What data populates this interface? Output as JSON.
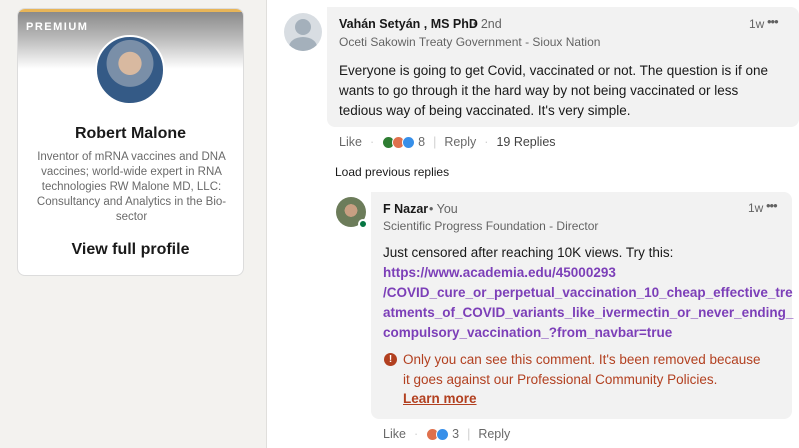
{
  "profile": {
    "badge": "PREMIUM",
    "name": "Robert Malone",
    "headline": "Inventor of mRNA vaccines and DNA vaccines; world-wide expert in RNA technologies RW Malone MD, LLC: Consultancy and Analytics in the Bio-sector",
    "view_profile": "View full profile"
  },
  "comment": {
    "author": "Vahán Setyán , MS PhD",
    "degree": "• 2nd",
    "subtitle": "Oceti Sakowin Treaty Government - Sioux Nation",
    "time": "1w",
    "more": "•••",
    "text": "Everyone is going to get Covid, vaccinated or not. The question is if one wants to go through it the hard way by not being vaccinated or less tedious way of being vaccinated. It's very simple.",
    "like": "Like",
    "reaction_count": "8",
    "reply": "Reply",
    "replies": "19 Replies"
  },
  "load_previous": "Load previous replies",
  "reply": {
    "author": "F Nazar",
    "you": "• You",
    "subtitle": "Scientific Progress Foundation - Director",
    "time": "1w",
    "more": "•••",
    "text_intro": "Just censored after reaching 10K views. Try this:",
    "link_line1": "https://www.academia.edu/45000293",
    "link_line2": "/COVID_cure_or_perpetual_vaccination_10_cheap_effective_tre",
    "link_line3": "atments_of_COVID_variants_like_ivermectin_or_never_ending_",
    "link_line4": "compulsory_vaccination_?from_navbar=true",
    "warning_line1": "Only you can see this comment. It's been removed because",
    "warning_line2": "it goes against our Professional Community Policies.",
    "learn_more": "Learn more",
    "like": "Like",
    "reaction_count": "3",
    "reply_label": "Reply"
  },
  "colors": {
    "link": "#7c3fb8",
    "warning": "#b24020",
    "premium_accent": "#e8b558"
  }
}
